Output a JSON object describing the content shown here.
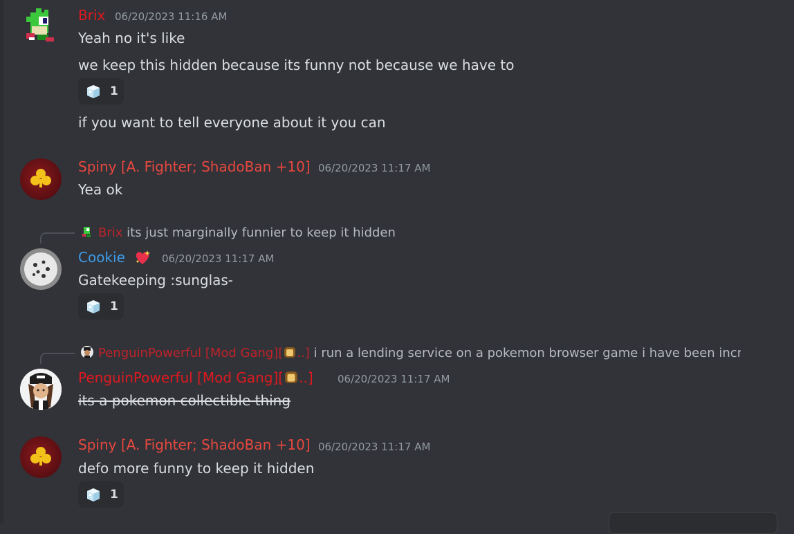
{
  "messages": [
    {
      "author": "Brix",
      "timestamp": "06/20/2023 11:16 AM",
      "lines": [
        "Yeah no it's like",
        "we keep this hidden because its funny not because we have to",
        "if you want to tell everyone about it you can"
      ],
      "reaction": {
        "icon": "ice-cube-icon",
        "count": "1"
      }
    },
    {
      "author": "Spiny [A. Fighter; ShadoBan +10]",
      "timestamp": "06/20/2023 11:17 AM",
      "text": "Yea ok"
    },
    {
      "reply_to": {
        "author": "Brix",
        "text": "its just marginally funnier to keep it hidden"
      },
      "author": "Cookie",
      "badge": "sparkling-heart-icon",
      "timestamp": "06/20/2023 11:17 AM",
      "text": "Gatekeeping :sunglas-",
      "reaction": {
        "icon": "ice-cube-icon",
        "count": "1"
      }
    },
    {
      "reply_to": {
        "author_prefix": "PenguinPowerful [Mod Gang][",
        "author_suffix": "..]",
        "text": "i run a lending service on a pokemon browser game i have been incre"
      },
      "author_prefix": "PenguinPowerful [Mod Gang][",
      "author_suffix": "..]",
      "timestamp": "06/20/2023 11:17 AM",
      "text": "its a pokemon collectible thing"
    },
    {
      "author": "Spiny [A. Fighter; ShadoBan +10]",
      "timestamp": "06/20/2023 11:17 AM",
      "text": "defo more funny to keep it hidden",
      "reaction": {
        "icon": "ice-cube-icon",
        "count": "1"
      }
    }
  ],
  "colors": {
    "background": "#313338",
    "brix_red": "#e0191f",
    "spiny_red": "#e9473f",
    "cookie_blue": "#3d9be9",
    "penguin_red": "#e0191f",
    "text": "#dbdee1",
    "timestamp": "#949ba4"
  }
}
